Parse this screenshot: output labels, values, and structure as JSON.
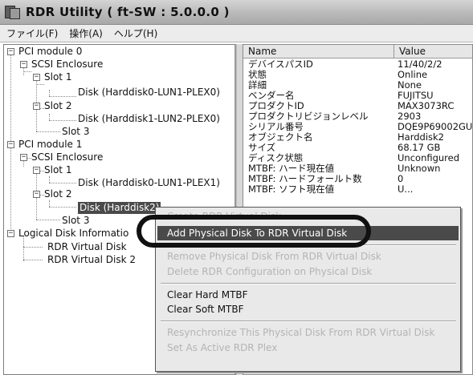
{
  "window": {
    "title": "RDR Utility  ( ft-SW : 5.0.0.0 )"
  },
  "menubar": {
    "items": [
      "ファイル(F)",
      "操作(A)",
      "ヘルプ(H)"
    ]
  },
  "tree": {
    "nodes": [
      {
        "label": "PCI module 0",
        "expander": "-"
      },
      {
        "label": "SCSI Enclosure",
        "expander": "-"
      },
      {
        "label": "Slot 1",
        "expander": "-"
      },
      {
        "label": "Disk (Harddisk0-LUN1-PLEX0)",
        "expander": ""
      },
      {
        "label": "Slot 2",
        "expander": "-"
      },
      {
        "label": "Disk (Harddisk1-LUN2-PLEX0)",
        "expander": ""
      },
      {
        "label": "Slot 3",
        "expander": ""
      },
      {
        "label": "PCI module 1",
        "expander": "-"
      },
      {
        "label": "SCSI Enclosure",
        "expander": "-"
      },
      {
        "label": "Slot 1",
        "expander": "-"
      },
      {
        "label": "Disk (Harddisk0-LUN1-PLEX1)",
        "expander": ""
      },
      {
        "label": "Slot 2",
        "expander": "-"
      },
      {
        "label": "Disk (Harddisk2)",
        "expander": ""
      },
      {
        "label": "Slot 3",
        "expander": ""
      },
      {
        "label": "Logical Disk Informatio",
        "expander": "-"
      },
      {
        "label": "RDR Virtual Disk",
        "expander": ""
      },
      {
        "label": "RDR Virtual Disk 2",
        "expander": ""
      }
    ]
  },
  "properties": {
    "headers": {
      "name": "Name",
      "value": "Value"
    },
    "rows": [
      {
        "name": "デバイスパスID",
        "value": "11/40/2/2"
      },
      {
        "name": "状態",
        "value": "Online"
      },
      {
        "name": "詳細",
        "value": "None"
      },
      {
        "name": "ベンダー名",
        "value": "FUJITSU"
      },
      {
        "name": "プロダクトID",
        "value": "MAX3073RC"
      },
      {
        "name": "プロダクトリビジョンレベル",
        "value": "2903"
      },
      {
        "name": "シリアル番号",
        "value": "DQE9P69002GU"
      },
      {
        "name": "オブジェクト名",
        "value": "Harddisk2"
      },
      {
        "name": "サイズ",
        "value": "68.17 GB"
      },
      {
        "name": "ディスク状態",
        "value": "Unconfigured"
      },
      {
        "name": "MTBF: ハード現在値",
        "value": "Unknown"
      },
      {
        "name": "MTBF: ハードフォールト数",
        "value": "0"
      },
      {
        "name": "MTBF: ソフト現在値",
        "value": "U..."
      }
    ]
  },
  "context_menu": {
    "items": [
      {
        "label": "Create RDR Virtual Disk",
        "disabled": true
      },
      {
        "label": "Add Physical Disk To RDR Virtual Disk",
        "highlight": true
      },
      {
        "label": "Remove Physical Disk From RDR Virtual Disk",
        "disabled": true
      },
      {
        "label": "Delete RDR Configuration on Physical Disk",
        "disabled": true
      },
      {
        "label": "Clear Hard MTBF",
        "disabled": false
      },
      {
        "label": "Clear Soft MTBF",
        "disabled": false
      },
      {
        "label": "Resynchronize This Physical Disk From RDR Virtual Disk",
        "disabled": true
      },
      {
        "label": "Set As Active RDR Plex",
        "disabled": true
      }
    ]
  },
  "colors": {
    "highlight_bg": "#4a4a4a",
    "disabled_text": "#b4b4b4",
    "menu_bg": "#e9e9e9"
  }
}
